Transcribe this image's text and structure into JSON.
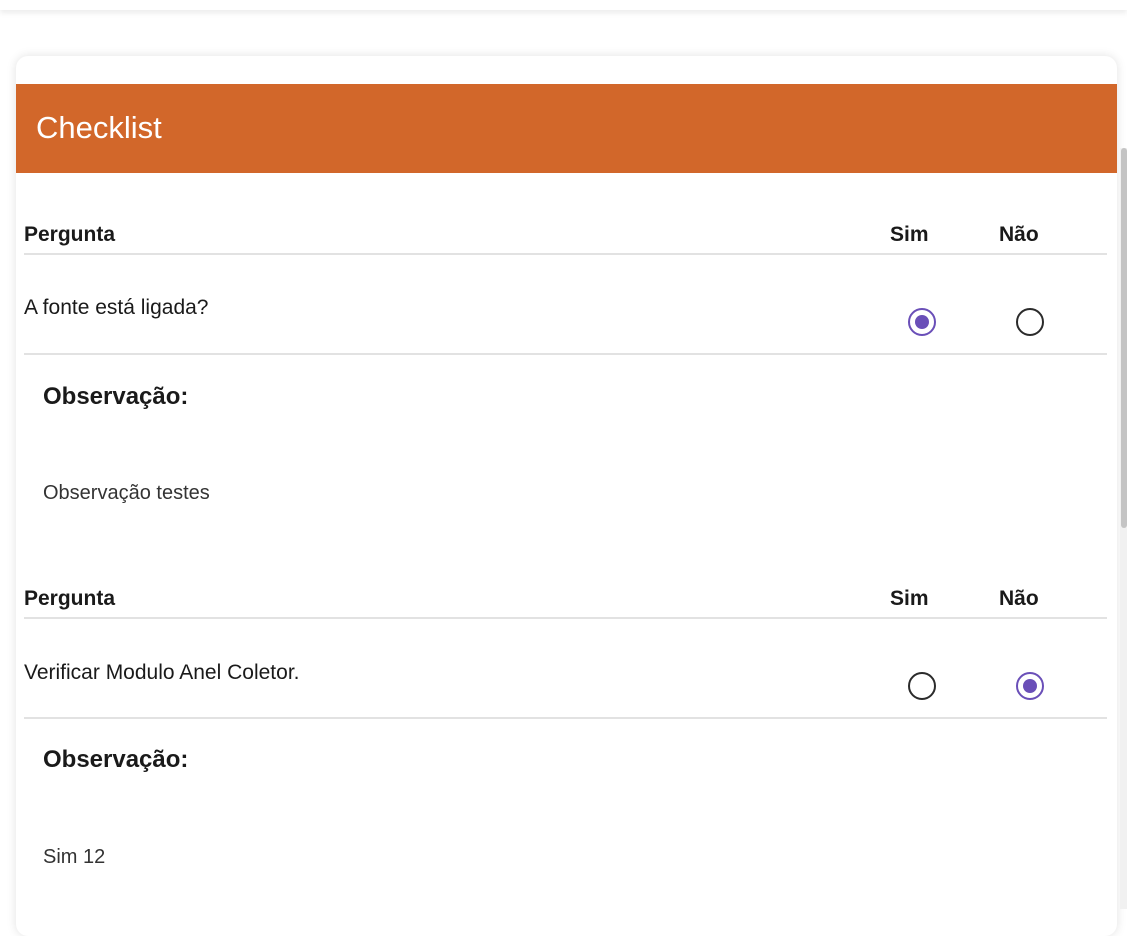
{
  "checklist": {
    "title": "Checklist",
    "header_color": "#d2672a",
    "radio_checked_color": "#6a4fb8",
    "columns": {
      "question": "Pergunta",
      "yes": "Sim",
      "no": "Não"
    },
    "items": [
      {
        "question": "A fonte está ligada?",
        "answer": "Sim",
        "observation_label": "Observação:",
        "observation": "Observação testes"
      },
      {
        "question": "Verificar Modulo Anel Coletor.",
        "answer": "Não",
        "observation_label": "Observação:",
        "observation": "Sim 12"
      }
    ]
  }
}
